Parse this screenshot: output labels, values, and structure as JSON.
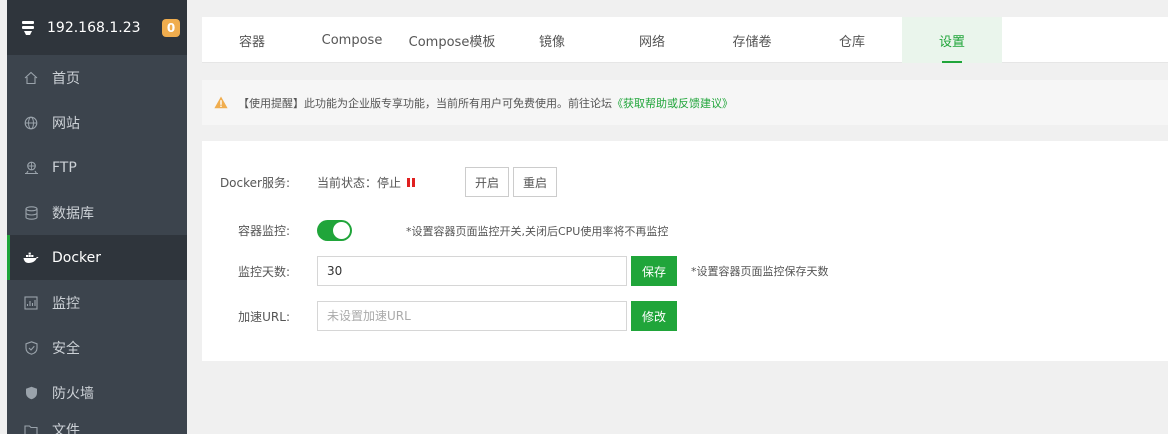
{
  "sidebar": {
    "server_ip": "192.168.1.23",
    "badge_count": "0",
    "items": [
      {
        "label": "首页",
        "icon": "home-icon"
      },
      {
        "label": "网站",
        "icon": "globe-icon"
      },
      {
        "label": "FTP",
        "icon": "ftp-icon"
      },
      {
        "label": "数据库",
        "icon": "database-icon"
      },
      {
        "label": "Docker",
        "icon": "docker-icon",
        "active": true
      },
      {
        "label": "监控",
        "icon": "monitor-icon"
      },
      {
        "label": "安全",
        "icon": "shield-icon"
      },
      {
        "label": "防火墙",
        "icon": "firewall-icon"
      },
      {
        "label": "文件",
        "icon": "folder-icon"
      }
    ]
  },
  "tabs": [
    {
      "label": "容器"
    },
    {
      "label": "Compose"
    },
    {
      "label": "Compose模板"
    },
    {
      "label": "镜像"
    },
    {
      "label": "网络"
    },
    {
      "label": "存储卷"
    },
    {
      "label": "仓库"
    },
    {
      "label": "设置",
      "active": true
    }
  ],
  "alert": {
    "text": "【使用提醒】此功能为企业版专享功能，当前所有用户可免费使用。前往论坛",
    "link": "《获取帮助或反馈建议》"
  },
  "settings": {
    "docker_service": {
      "label": "Docker服务:",
      "status_text": "当前状态：停止",
      "start_button": "开启",
      "restart_button": "重启"
    },
    "container_monitor": {
      "label": "容器监控:",
      "enabled": true,
      "hint": "*设置容器页面监控开关,关闭后CPU使用率将不再监控"
    },
    "monitor_days": {
      "label": "监控天数:",
      "value": "30",
      "save_button": "保存",
      "hint": "*设置容器页面监控保存天数"
    },
    "accelerate_url": {
      "label": "加速URL:",
      "value": "",
      "placeholder": "未设置加速URL",
      "modify_button": "修改"
    }
  },
  "colors": {
    "accent": "#20a53a",
    "sidebar_bg": "#3c444d",
    "sidebar_active": "#2f353c",
    "badge": "#f0ad4e",
    "stopped": "#e02020"
  }
}
